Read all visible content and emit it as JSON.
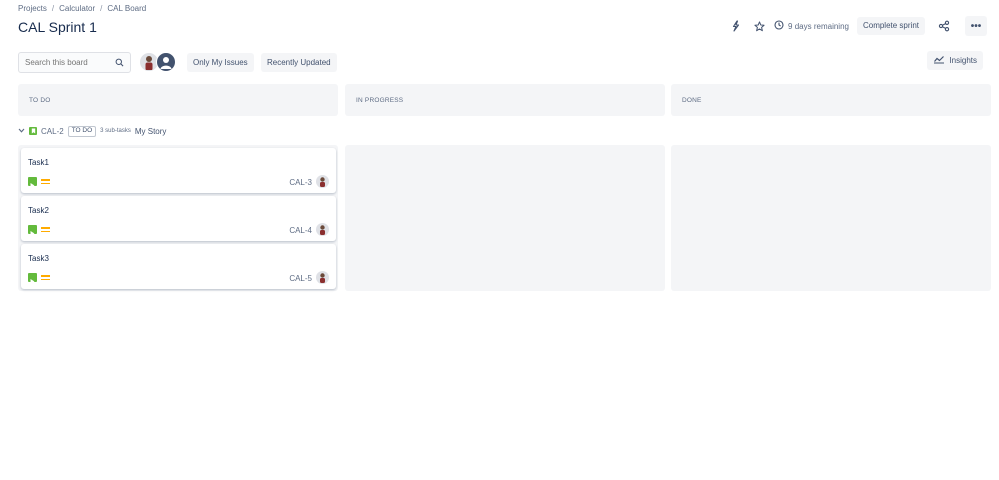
{
  "breadcrumb": {
    "items": [
      "Projects",
      "Calculator",
      "CAL Board"
    ],
    "separator": "/"
  },
  "page_title": "CAL Sprint 1",
  "toolbar": {
    "remaining": "9 days remaining",
    "complete_sprint": "Complete sprint",
    "more": "•••",
    "insights": "Insights"
  },
  "filters": {
    "search_placeholder": "Search this board",
    "only_my_issues": "Only My Issues",
    "recently_updated": "Recently Updated"
  },
  "columns": [
    {
      "title": "TO DO"
    },
    {
      "title": "IN PROGRESS"
    },
    {
      "title": "DONE"
    }
  ],
  "swimlane": {
    "key": "CAL-2",
    "status": "TO DO",
    "subtasks": "3 sub-tasks",
    "summary": "My Story"
  },
  "cards": [
    {
      "title": "Task1",
      "key": "CAL-3"
    },
    {
      "title": "Task2",
      "key": "CAL-4"
    },
    {
      "title": "Task3",
      "key": "CAL-5"
    }
  ],
  "colors": {
    "story": "#63ba3c",
    "subtask": "#63ba3c",
    "priority_medium": "#ffab00",
    "column_bg": "#f4f5f7"
  },
  "icons": [
    "release-icon",
    "star-icon",
    "clock-icon",
    "share-icon",
    "more-icon",
    "search-icon",
    "insights-chart-icon",
    "chevron-down-icon",
    "story-icon",
    "subtask-icon",
    "priority-medium-icon"
  ]
}
